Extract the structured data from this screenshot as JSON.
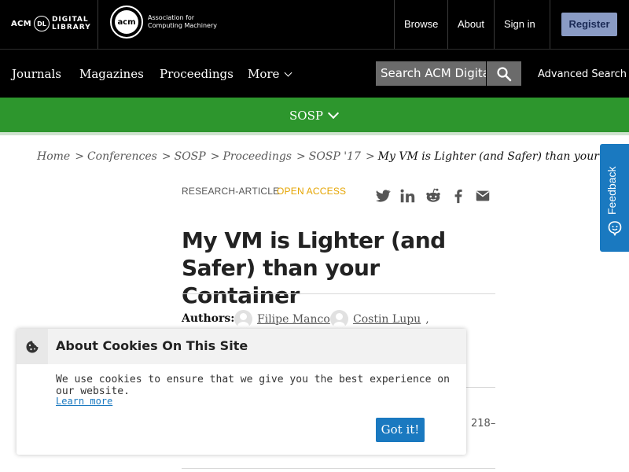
{
  "header": {
    "dl_logo": {
      "acm": "ACM",
      "badge": "DL",
      "line1": "DIGITAL",
      "line2": "LIBRARY"
    },
    "acm_logo": {
      "mark": "acm",
      "line1": "Association for",
      "line2": "Computing Machinery"
    },
    "links": {
      "browse": "Browse",
      "about": "About",
      "sign_in": "Sign in",
      "register": "Register"
    }
  },
  "nav": {
    "items": [
      "Journals",
      "Magazines",
      "Proceedings",
      "More"
    ],
    "search_placeholder": "Search ACM Digital Library",
    "advanced_search": "Advanced Search",
    "search_icon": "search-icon"
  },
  "conference_bar": {
    "label": "SOSP"
  },
  "breadcrumb": [
    "Home",
    "Conferences",
    "SOSP",
    "Proceedings",
    "SOSP '17",
    "My VM is Lighter (and Safer) than your Container"
  ],
  "feedback": {
    "label": "Feedback"
  },
  "article": {
    "type": "RESEARCH-ARTICLE",
    "access": "OPEN ACCESS",
    "title": "My VM is Lighter (and Safer) than your Container",
    "authors_label": "Authors:",
    "authors": [
      "Filipe Manco",
      "Costin Lupu"
    ],
    "pages_fragment": "218–"
  },
  "share_icons": [
    "twitter-icon",
    "linkedin-icon",
    "reddit-icon",
    "facebook-icon",
    "email-icon"
  ],
  "cookie": {
    "title": "About Cookies On This Site",
    "body": "We use cookies to ensure that we give you the best experience on our website.",
    "learn_more": "Learn more",
    "button": "Got it!"
  },
  "colors": {
    "accent_green": "#2d962d",
    "accent_blue": "#1a79c0",
    "open_access": "#e5a400",
    "register_bg": "#8a9bc4"
  }
}
